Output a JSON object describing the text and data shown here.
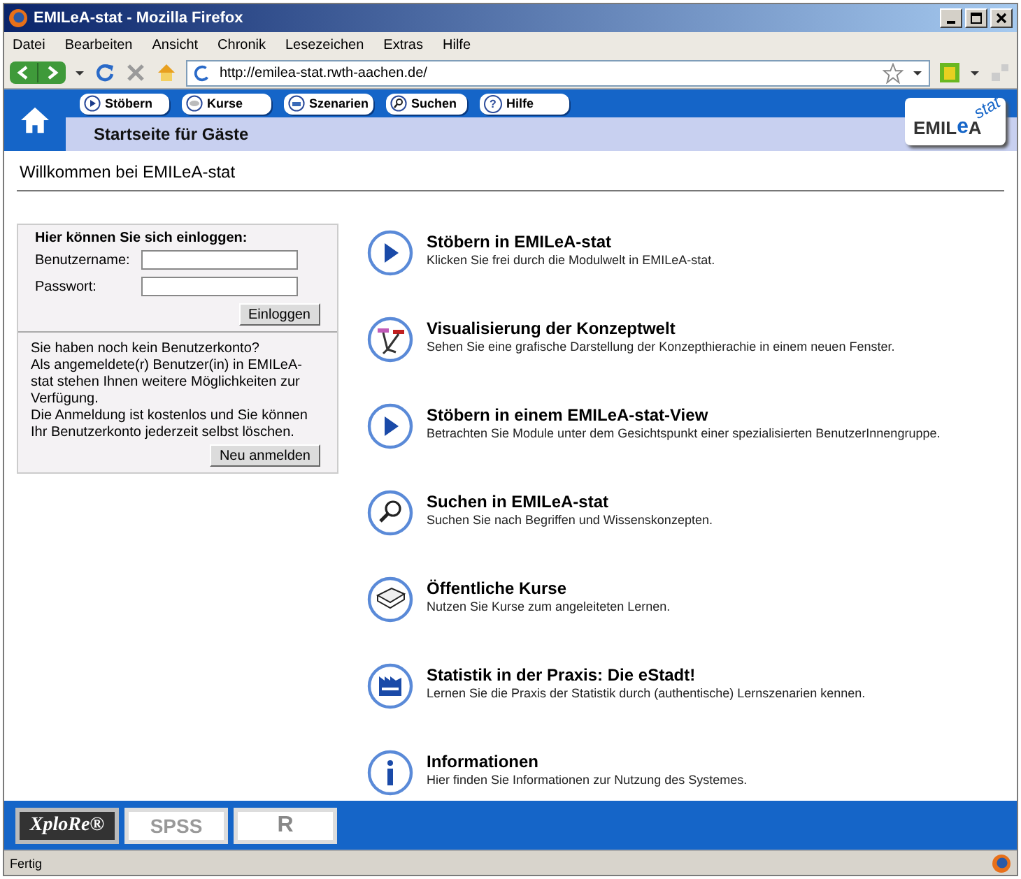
{
  "window": {
    "title": "EMILeA-stat - Mozilla Firefox"
  },
  "menu": [
    "Datei",
    "Bearbeiten",
    "Ansicht",
    "Chronik",
    "Lesezeichen",
    "Extras",
    "Hilfe"
  ],
  "address": {
    "value": "http://emilea-stat.rwth-aachen.de/"
  },
  "site_nav": [
    {
      "label": "Stöbern",
      "kind": "play"
    },
    {
      "label": "Kurse",
      "kind": "disc"
    },
    {
      "label": "Szenarien",
      "kind": "tray"
    },
    {
      "label": "Suchen",
      "kind": "search"
    },
    {
      "label": "Hilfe",
      "kind": "text",
      "glyph": "?"
    }
  ],
  "page_subtitle": "Startseite für Gäste",
  "logo": {
    "main": "EMIL",
    "e": "e",
    "a": "A",
    "stat": "stat"
  },
  "heading": "Willkommen bei EMILeA-stat",
  "login": {
    "title": "Hier können Sie sich einloggen:",
    "username_label": "Benutzername:",
    "password_label": "Passwort:",
    "submit": "Einloggen",
    "info": [
      "Sie haben noch kein Benutzerkonto?",
      "Als angemeldete(r) Benutzer(in) in EMILeA-stat stehen Ihnen weitere Möglichkeiten zur Verfügung.",
      "Die Anmeldung ist kostenlos und Sie können Ihr Benutzerkonto jederzeit selbst löschen."
    ],
    "register": "Neu anmelden"
  },
  "features": [
    {
      "kind": "play",
      "title": "Stöbern in EMILeA-stat",
      "text": "Klicken Sie frei durch die Modulwelt in EMILeA-stat."
    },
    {
      "kind": "network",
      "title": "Visualisierung der Konzeptwelt",
      "text": "Sehen Sie eine grafische Darstellung der Konzepthierachie in einem neuen Fenster."
    },
    {
      "kind": "play",
      "title": "Stöbern in einem EMILeA-stat-View",
      "text": "Betrachten Sie Module unter dem Gesichtspunkt einer spezialisierten BenutzerInnengruppe."
    },
    {
      "kind": "search",
      "title": "Suchen in EMILeA-stat",
      "text": "Suchen Sie nach Begriffen und Wissenskonzepten."
    },
    {
      "kind": "book",
      "title": "Öffentliche Kurse",
      "text": "Nutzen Sie Kurse zum angeleiteten Lernen."
    },
    {
      "kind": "factory",
      "title": "Statistik in der Praxis: Die eStadt!",
      "text": "Lernen Sie die Praxis der Statistik durch (authentische) Lernszenarien kennen."
    },
    {
      "kind": "info",
      "title": "Informationen",
      "text": "Hier finden Sie Informationen zur Nutzung des Systemes."
    }
  ],
  "footer_logos": [
    {
      "kind": "dark",
      "label": "XploRe®"
    },
    {
      "kind": "light",
      "label": "SPSS"
    },
    {
      "kind": "ring",
      "label": "R"
    }
  ],
  "status_bar": "Fertig"
}
